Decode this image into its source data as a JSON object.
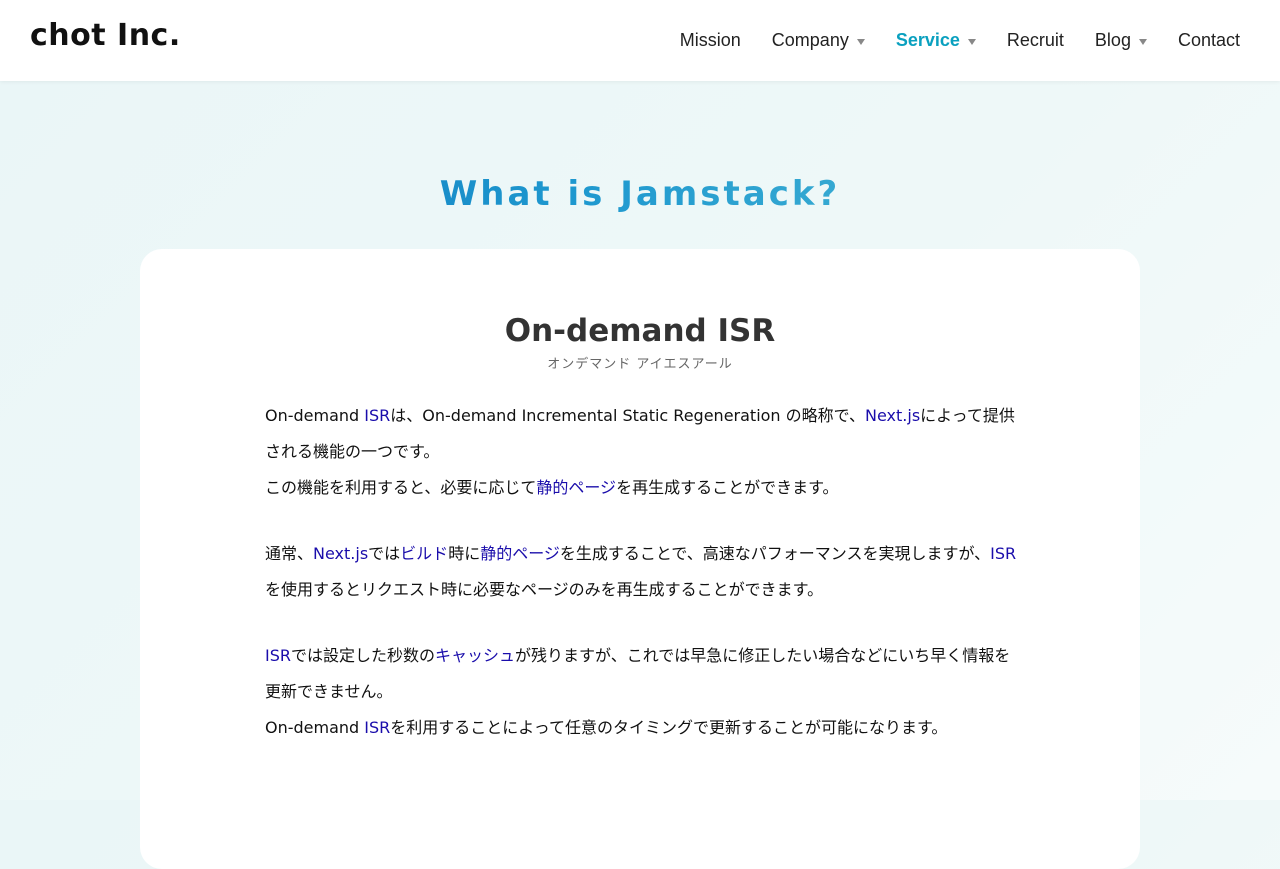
{
  "header": {
    "logo": "chot Inc.",
    "nav": [
      {
        "label": "Mission"
      },
      {
        "label": "Company"
      },
      {
        "label": "Service"
      },
      {
        "label": "Recruit"
      },
      {
        "label": "Blog"
      },
      {
        "label": "Contact"
      }
    ],
    "active_color": "#0aa0bf"
  },
  "section": {
    "title": "What is Jamstack?"
  },
  "article": {
    "title": "On-demand ISR",
    "reading": "オンデマンド アイエスアール",
    "p1": [
      {
        "t": "On-demand "
      },
      {
        "t": "ISR",
        "link": true
      },
      {
        "t": "は、On-demand Incremental Static Regeneration の略称で、"
      },
      {
        "t": "Next.js",
        "link": true
      },
      {
        "t": "によって提供される機能の一つです。"
      },
      {
        "br": true
      },
      {
        "t": "この機能を利用すると、必要に応じて"
      },
      {
        "t": "静的ページ",
        "link": true
      },
      {
        "t": "を再生成することができます。"
      }
    ],
    "p2": [
      {
        "t": "通常、"
      },
      {
        "t": "Next.js",
        "link": true
      },
      {
        "t": "では"
      },
      {
        "t": "ビルド",
        "link": true
      },
      {
        "t": "時に"
      },
      {
        "t": "静的ページ",
        "link": true
      },
      {
        "t": "を生成することで、高速なパフォーマンスを実現しますが、"
      },
      {
        "t": "ISR",
        "link": true
      },
      {
        "t": "を使用するとリクエスト時に必要なページのみを再生成することができます。"
      }
    ],
    "p3": [
      {
        "t": "ISR",
        "link": true
      },
      {
        "t": "では設定した秒数の"
      },
      {
        "t": "キャッシュ",
        "link": true
      },
      {
        "t": "が残りますが、これでは早急に修正したい場合などにいち早く情報を更新できません。"
      },
      {
        "br": true
      },
      {
        "t": "On-demand "
      },
      {
        "t": "ISR",
        "link": true
      },
      {
        "t": "を利用することによって任意のタイミングで更新することが可能になります。"
      }
    ],
    "link_color": "#1a0dab"
  }
}
